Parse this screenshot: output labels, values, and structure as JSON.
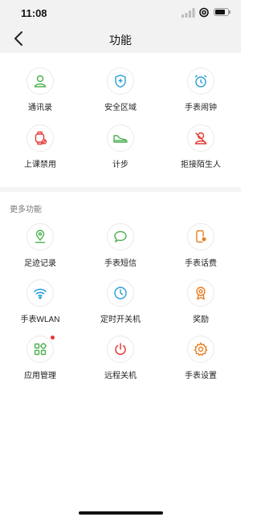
{
  "status_bar": {
    "time": "11:08"
  },
  "header": {
    "title": "功能"
  },
  "main_features": [
    {
      "label": "通讯录",
      "icon": "contacts-icon",
      "color": "#4caf50"
    },
    {
      "label": "安全区域",
      "icon": "shield-icon",
      "color": "#2a9fd6"
    },
    {
      "label": "手表闹钟",
      "icon": "alarm-clock-icon",
      "color": "#2a9fd6"
    },
    {
      "label": "上课禁用",
      "icon": "watch-disabled-icon",
      "color": "#e53935"
    },
    {
      "label": "计步",
      "icon": "shoe-icon",
      "color": "#4caf50"
    },
    {
      "label": "拒接陌生人",
      "icon": "block-stranger-icon",
      "color": "#e53935"
    }
  ],
  "more_section": {
    "title": "更多功能"
  },
  "more_features": [
    {
      "label": "足迹记录",
      "icon": "location-pin-icon",
      "color": "#4caf50"
    },
    {
      "label": "手表短信",
      "icon": "chat-bubble-icon",
      "color": "#4caf50"
    },
    {
      "label": "手表话费",
      "icon": "phone-bill-icon",
      "color": "#e67e22"
    },
    {
      "label": "手表WLAN",
      "icon": "wifi-icon",
      "color": "#2a9fd6"
    },
    {
      "label": "定时开关机",
      "icon": "clock-icon",
      "color": "#2a9fd6"
    },
    {
      "label": "奖励",
      "icon": "award-medal-icon",
      "color": "#e67e22"
    },
    {
      "label": "应用管理",
      "icon": "apps-grid-icon",
      "color": "#4caf50",
      "badge": true
    },
    {
      "label": "远程关机",
      "icon": "power-icon",
      "color": "#e53935"
    },
    {
      "label": "手表设置",
      "icon": "gear-icon",
      "color": "#e67e22"
    }
  ]
}
